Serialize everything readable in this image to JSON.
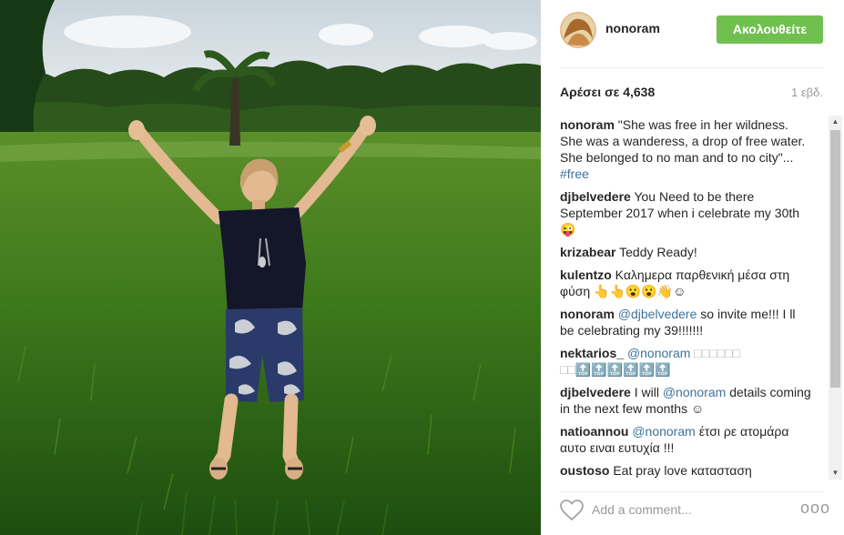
{
  "post": {
    "username": "nonoram",
    "follow_label": "Ακολουθείτε",
    "likes": "Αρέσει σε 4,638",
    "time": "1 εβδ."
  },
  "comments": [
    {
      "user": "nonoram",
      "text": "\"She was free in her wildness. She was a wanderess, a drop of free water. She belonged to no man and to no city\"...",
      "tag": "#free"
    },
    {
      "user": "djbelvedere",
      "text": "You Need to be there September 2017 when i celebrate my 30th 😜"
    },
    {
      "user": "krizabear",
      "text": "Teddy Ready!"
    },
    {
      "user": "kulentzo",
      "text": "Καλημερα παρθενική μέσα στη φύση 👆👆😮😮👋☺"
    },
    {
      "user": "nonoram",
      "mention": "@djbelvedere",
      "text": "so invite me!!! I ll be celebrating my 39!!!!!!!"
    },
    {
      "user": "nektarios_",
      "mention": "@nonoram",
      "text": "□□□□□□ □□🔝🔝🔝🔝🔝🔝"
    },
    {
      "user": "djbelvedere",
      "text_before": "I will",
      "mention": "@nonoram",
      "text": "details coming in the next few months ☺"
    },
    {
      "user": "natioannou",
      "mention": "@nonoram",
      "text": "έτσι ρε ατομάρα αυτο ειναι ευτυχία !!!"
    },
    {
      "user": "oustoso",
      "text": "Eat pray love κατασταση"
    }
  ],
  "footer": {
    "comment_placeholder": "Add a comment...",
    "more_label": "ooo"
  },
  "scrollbar": {
    "up": "▲",
    "down": "▼"
  },
  "icons": {
    "heart": "heart-icon",
    "more": "more-options-icon"
  },
  "colors": {
    "follow_button": "#70c050",
    "link": "#3f729b",
    "muted": "#999999"
  }
}
